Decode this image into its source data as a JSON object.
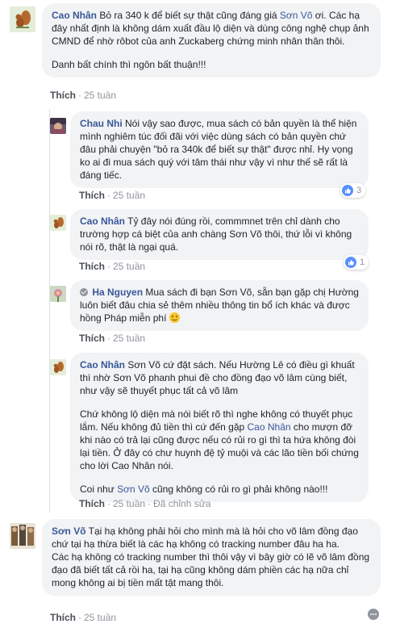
{
  "actions": {
    "like": "Thích",
    "dot": "·"
  },
  "comments": [
    {
      "author": "Cao Nhân",
      "inline": "Bỏ ra 340 k để biết sự thật cũng đáng giá",
      "mention": "Sơn Võ",
      "inline_tail": "ơi. Các hạ đây nhất định là không dám xuất đầu lộ diện và dùng công nghệ chụp ảnh CMND để nhờ rôbot của anh Zuckaberg chứng minh nhân thân thôi.",
      "para2": "Danh bất chính thì ngôn bất thuận!!!",
      "time": "25 tuần"
    },
    {
      "author": "Chau Nhi",
      "text": "Nói vậy sao được, mua sách có bản quyền là thể hiện mình nghiêm túc đối đãi với việc dùng sách có bản quyền chứ đâu phải chuyện \"bỏ ra 340k để biết sự thật\" được nhỉ. Hy vọng ko ai đi mua sách quý với tâm thái như vậy vì như thế sẽ rất là đáng tiếc.",
      "time": "25 tuần",
      "reactions": "3"
    },
    {
      "author": "Cao Nhân",
      "text": "Tỷ đây nói đúng rồi, commmnet trên chỉ dành cho trường hợp cá biệt của anh chàng Sơn Võ thôi, thứ lỗi vì không nói rõ, thật là ngại quá.",
      "time": "25 tuần",
      "reactions": "1"
    },
    {
      "author": "Ha Nguyen",
      "text": "Mua sách đi bạn Sơn Võ, sẵn bạn gặp chị Hường luôn biết đâu chia sẻ thêm nhiều thông tin bổ ích khác và được hồng Pháp miễn phí",
      "time": "25 tuần"
    },
    {
      "author": "Cao Nhân",
      "text1": "Sơn Võ cứ đặt sách. Nếu Hường Lê có điều gì khuất thì nhờ Sơn Võ phanh phui đề cho đồng đạo võ lâm cùng biết, như vậy sẽ thuyết phục tất cả võ lâm",
      "text2_a": "Chứ không lộ diện mà nói biết rõ thì nghe không có thuyết phục lắm. Nếu không đủ tiền thì cứ đến gặp",
      "text2_mention": "Cao Nhân",
      "text2_b": "cho mượn đỡ khi nào có trả lại cũng được nếu có rủi ro gì thì ta hứa không đòi lại tiền. Ở đây có chư huynh đệ tỷ muội và các lão tiền bối chứng cho lời Cao Nhân nói.",
      "text3_a": "Coi như",
      "text3_mention": "Sơn Võ",
      "text3_b": "cũng không có rủi ro gì phải không nào!!!",
      "time": "25 tuần",
      "edited": "Đã chỉnh sửa"
    },
    {
      "author": "Sơn Võ",
      "text1": "Tại hạ không phải hỏi cho mình mà là hỏi cho võ lâm đồng đạo chứ tại hạ thừa biết là các hạ không có tracking number đâu ha ha.",
      "text2": "Các hạ không có tracking number thì thôi vậy vì bây giờ có lẽ võ lâm đồng đạo đã biết tất cả rồi ha, tại hạ cũng không dám phiền các hạ nữa chỉ mong không ai bị tiền mất tật mang thôi.",
      "time": "25 tuần"
    }
  ],
  "colors": {
    "link": "#385898",
    "bubble": "#f2f3f5",
    "like": "#5890ff"
  },
  "icons": [
    "squirrel-avatar-icon",
    "like-icon",
    "verified-icon",
    "smiley-icon",
    "edit-icon",
    "more-icon"
  ]
}
